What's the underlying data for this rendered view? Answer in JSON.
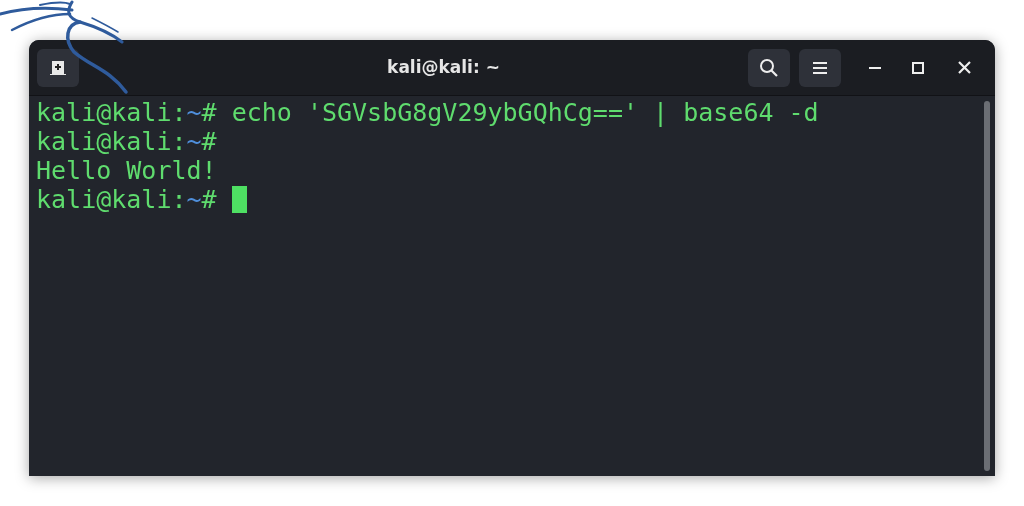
{
  "window": {
    "title": "kali@kali: ~"
  },
  "terminal": {
    "lines": [
      {
        "kind": "prompt",
        "user_host": "kali@kali:",
        "path": "~",
        "symbol": "#",
        "command": "echo 'SGVsbG8gV29ybGQhCg==' | base64 -d"
      },
      {
        "kind": "prompt",
        "user_host": "kali@kali:",
        "path": "~",
        "symbol": "#"
      },
      {
        "kind": "output",
        "text": "Hello World!"
      },
      {
        "kind": "prompt",
        "user_host": "kali@kali:",
        "path": "~",
        "symbol": "#",
        "cursor": true
      }
    ]
  }
}
